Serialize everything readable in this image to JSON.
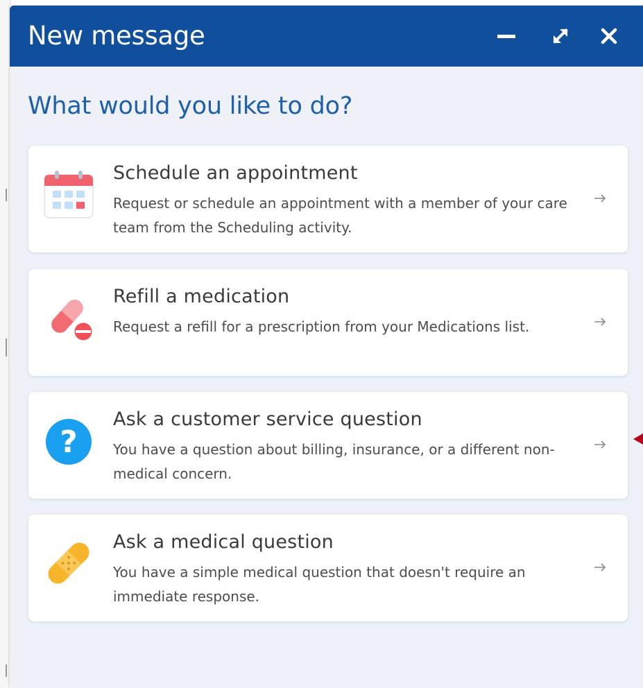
{
  "dialog": {
    "title": "New message",
    "question": "What would you like to do?",
    "controls": {
      "minimize_icon": "minimize-icon",
      "expand_icon": "expand-icon",
      "close_icon": "close-icon"
    }
  },
  "options": [
    {
      "title": "Schedule an appointment",
      "description": "Request or schedule an appointment with a member of your care team from the Scheduling activity.",
      "icon": "calendar-icon"
    },
    {
      "title": "Refill a medication",
      "description": "Request a refill for a prescription from your Medications list.",
      "icon": "pill-icon"
    },
    {
      "title": "Ask a customer service question",
      "description": "You have a question about billing, insurance, or a different non-medical concern.",
      "icon": "question-mark-icon"
    },
    {
      "title": "Ask a medical question",
      "description": "You have a simple medical question that doesn't require an immediate response.",
      "icon": "bandage-icon"
    }
  ],
  "colors": {
    "header": "#0f4f9b",
    "question_text": "#1e5fa8",
    "panel_background": "#eef2f8",
    "calendar": "#f0636e",
    "pill": "#f26b73",
    "question_icon": "#1aa0f0",
    "bandage": "#f7b52c",
    "pointer": "#b3001b"
  }
}
